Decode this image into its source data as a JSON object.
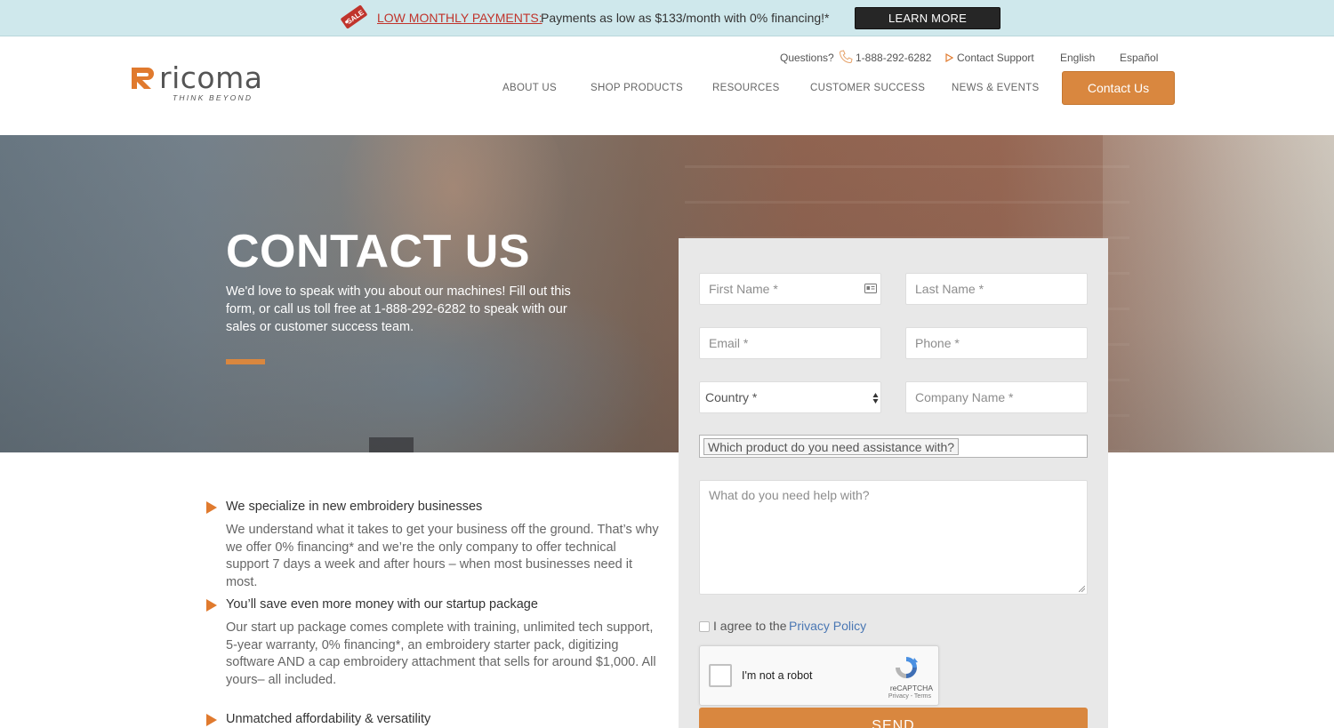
{
  "promo": {
    "sale_badge": "SALE",
    "highlight": "LOW MONTHLY PAYMENTS:",
    "text": "Payments as low as $133/month with 0% financing!*",
    "learn_more": "LEARN MORE"
  },
  "header": {
    "logo_word": "ricoma",
    "logo_tagline": "THINK BEYOND",
    "questions": "Questions?",
    "phone": "1-888-292-6282",
    "contact_support": "Contact Support",
    "lang_en": "English",
    "lang_es": "Español",
    "nav": [
      "ABOUT US",
      "SHOP PRODUCTS",
      "RESOURCES",
      "CUSTOMER SUCCESS",
      "NEWS & EVENTS"
    ],
    "contact_button": "Contact Us"
  },
  "hero": {
    "title": "CONTACT US",
    "subtitle": "We'd love to speak with you about our machines! Fill out this form, or call us toll free at 1-888-292-6282 to speak with our sales or customer success team."
  },
  "benefits": [
    {
      "title": "We specialize in new embroidery businesses",
      "body": "We understand what it takes to get your business off the ground. That’s why we offer 0% financing* and we’re the only company to offer technical support 7 days a week and after hours – when most businesses need it most."
    },
    {
      "title": "You’ll save even more money with our startup package",
      "body": "Our start up package comes complete with training, unlimited tech support, 5-year warranty, 0% financing*, an embroidery starter pack, digitizing software AND a cap embroidery attachment that sells for around $1,000. All yours– all included."
    },
    {
      "title": "Unmatched affordability & versatility",
      "body": ""
    }
  ],
  "form": {
    "first_name": "First Name *",
    "last_name": "Last Name *",
    "email": "Email *",
    "phone": "Phone *",
    "country": "Country *",
    "company": "Company Name *",
    "product": "Which product do you need assistance with?",
    "help": "What do you need help with?",
    "agree_prefix": "I agree to the",
    "agree_link": "Privacy Policy",
    "captcha_label": "I'm not a robot",
    "captcha_brand": "reCAPTCHA",
    "captcha_terms": "Privacy - Terms",
    "send": "SEND"
  },
  "colors": {
    "accent": "#d9873f",
    "promo_bg": "#cfe8ec",
    "sale_red": "#c0342c",
    "link_blue": "#4a77b3"
  }
}
